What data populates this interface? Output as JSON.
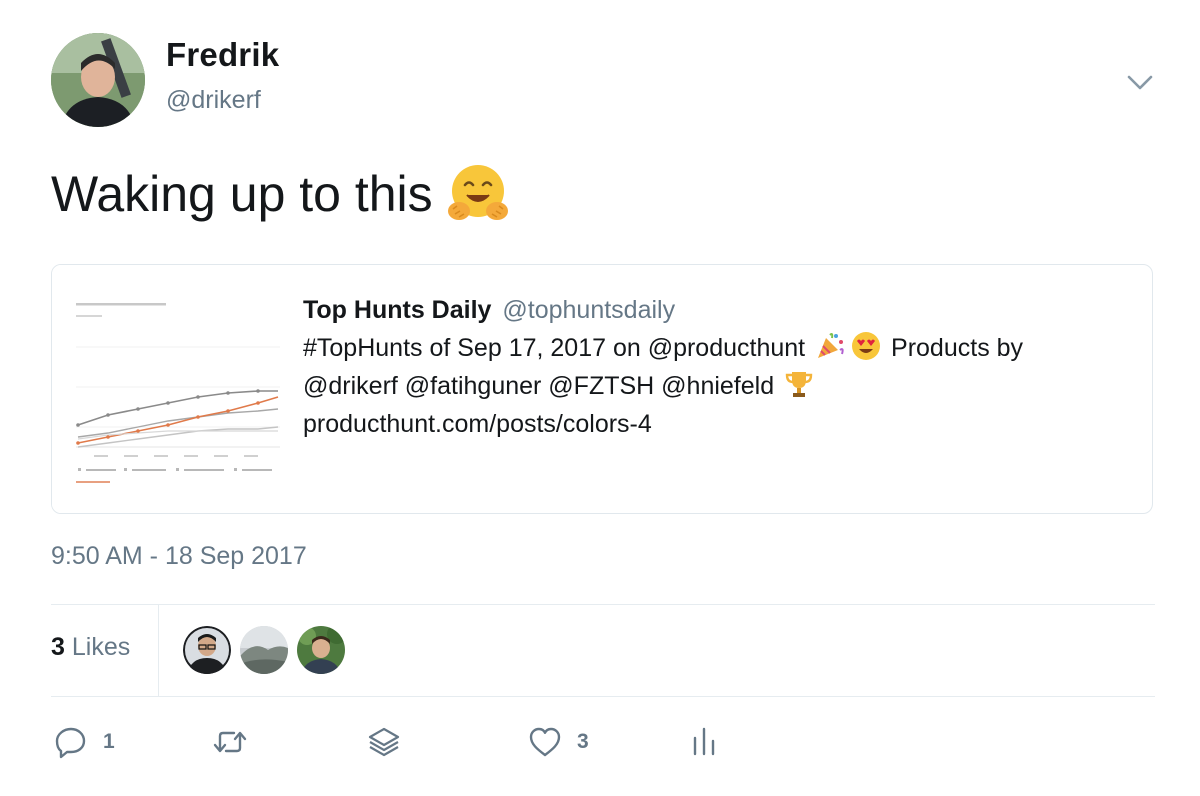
{
  "author": {
    "name": "Fredrik",
    "handle": "@drikerf"
  },
  "menu_icon": "chevron-down-icon",
  "tweet": {
    "text": "Waking up to this",
    "emoji": "hugging-face"
  },
  "quoted": {
    "author_name": "Top Hunts Daily",
    "author_handle": "@tophuntsdaily",
    "text_part1": "#TopHunts of Sep 17, 2017 on @producthunt",
    "text_part2": "Products by",
    "text_part3": "@drikerf @fatihguner @FZTSH @hniefeld",
    "link": "producthunt.com/posts/colors-4",
    "emojis": [
      "party-popper",
      "heart-eyes",
      "trophy"
    ]
  },
  "timestamp": "9:50 AM - 18 Sep 2017",
  "likes": {
    "count": "3",
    "label": "Likes",
    "avatars": [
      "liker-avatar-1",
      "liker-avatar-2",
      "liker-avatar-3"
    ]
  },
  "actions": {
    "reply_count": "1",
    "retweet_count": "",
    "like_count": "3"
  },
  "colors": {
    "text": "#14171a",
    "secondary": "#657786",
    "border": "#e1e8ed"
  }
}
